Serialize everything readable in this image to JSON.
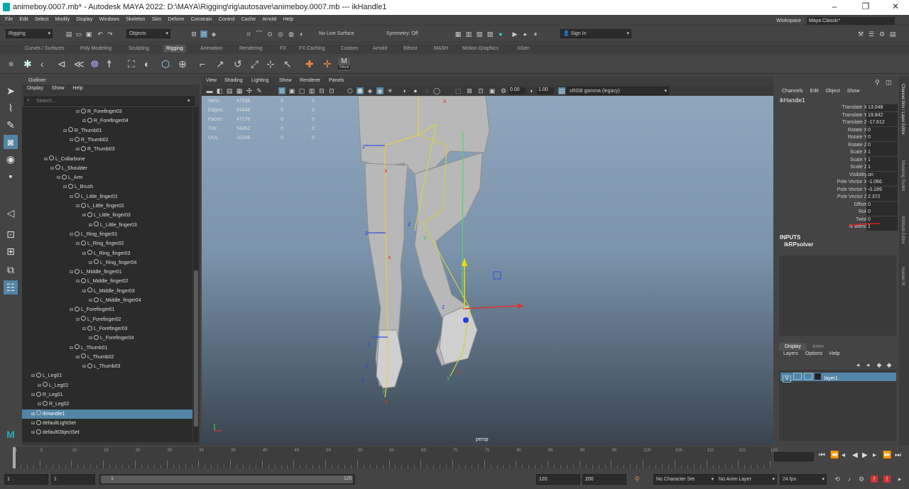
{
  "window": {
    "title": "animeboy.0007.mb* - Autodesk MAYA 2022: D:\\MAYA\\Rigging\\rig\\autosave\\animeboy.0007.mb  ---  ikHandle1"
  },
  "menubar": {
    "items": [
      "File",
      "Edit",
      "Select",
      "Modify",
      "Display",
      "Windows",
      "Skeleton",
      "Skin",
      "Deform",
      "Constrain",
      "Control",
      "Cache",
      "Arnold",
      "Help"
    ],
    "workspace_label": "Workspace :",
    "workspace_value": "Maya Classic*"
  },
  "statusline": {
    "menuset": "Rigging",
    "select_mode": "Objects",
    "live_surface": "No Live Surface",
    "symmetry": "Symmetry: Off",
    "sign_in": "Sign In"
  },
  "shelf": {
    "tabs": [
      "Curves / Surfaces",
      "Poly Modeling",
      "Sculpting",
      "Rigging",
      "Animation",
      "Rendering",
      "FX",
      "FX Caching",
      "Custom",
      "Arnold",
      "Bifrost",
      "MASH",
      "Motion Graphics",
      "XGen"
    ],
    "active": "Rigging",
    "orient_label": "Orient"
  },
  "outliner": {
    "title": "Outliner",
    "menu": [
      "Display",
      "Show",
      "Help"
    ],
    "search_placeholder": "Search...",
    "rows": [
      {
        "label": "R_Forefinger03",
        "depth": 8
      },
      {
        "label": "R_Forefinger04",
        "depth": 9
      },
      {
        "label": "R_Thumb01",
        "depth": 6
      },
      {
        "label": "R_Thumb02",
        "depth": 7
      },
      {
        "label": "R_Thumb03",
        "depth": 8
      },
      {
        "label": "L_Collarbone",
        "depth": 3
      },
      {
        "label": "L_Shoulder",
        "depth": 4
      },
      {
        "label": "L_Arm",
        "depth": 5
      },
      {
        "label": "L_Brush",
        "depth": 6
      },
      {
        "label": "L_Little_finger01",
        "depth": 7
      },
      {
        "label": "L_Little_finger02",
        "depth": 8
      },
      {
        "label": "L_Little_finger03",
        "depth": 9
      },
      {
        "label": "L_Little_finger03",
        "depth": 10
      },
      {
        "label": "L_Ring_finger01",
        "depth": 7
      },
      {
        "label": "L_Ring_finger02",
        "depth": 8
      },
      {
        "label": "L_Ring_finger03",
        "depth": 9
      },
      {
        "label": "L_Ring_finger04",
        "depth": 10
      },
      {
        "label": "L_Middle_finger01",
        "depth": 7
      },
      {
        "label": "L_Middle_finger02",
        "depth": 8
      },
      {
        "label": "L_Middle_finger03",
        "depth": 9
      },
      {
        "label": "L_Middle_finger04",
        "depth": 10
      },
      {
        "label": "L_Forefinger01",
        "depth": 7
      },
      {
        "label": "L_Forefinger02",
        "depth": 8
      },
      {
        "label": "L_Forefinger03",
        "depth": 9
      },
      {
        "label": "L_Forefinger04",
        "depth": 10
      },
      {
        "label": "L_Thumb01",
        "depth": 7
      },
      {
        "label": "L_Thumb02",
        "depth": 8
      },
      {
        "label": "L_Thumb03",
        "depth": 9
      },
      {
        "label": "L_Leg01",
        "depth": 1
      },
      {
        "label": "L_Leg02",
        "depth": 2
      },
      {
        "label": "R_Leg01",
        "depth": 1
      },
      {
        "label": "R_Leg02",
        "depth": 2
      },
      {
        "label": "ikHandle1",
        "depth": 1,
        "selected": true
      },
      {
        "label": "defaultLightSet",
        "depth": 1
      },
      {
        "label": "defaultObjectSet",
        "depth": 1
      }
    ]
  },
  "viewport": {
    "menu": [
      "View",
      "Shading",
      "Lighting",
      "Show",
      "Renderer",
      "Panels"
    ],
    "exposure": "0.00",
    "gamma": "1.00",
    "color_space": "sRGB gamma (legacy)",
    "camera": "persp",
    "hud": [
      {
        "label": "Verts:",
        "v1": "47336",
        "v2": "0",
        "v3": "0"
      },
      {
        "label": "Edges:",
        "v1": "94448",
        "v2": "0",
        "v3": "0"
      },
      {
        "label": "Faces:",
        "v1": "47176",
        "v2": "0",
        "v3": "0"
      },
      {
        "label": "Tris:",
        "v1": "94352",
        "v2": "0",
        "v3": "0"
      },
      {
        "label": "UVs:",
        "v1": "10348",
        "v2": "0",
        "v3": "0"
      }
    ]
  },
  "channelbox": {
    "menu": [
      "Channels",
      "Edit",
      "Object",
      "Show"
    ],
    "node": "ikHandle1",
    "attrs": [
      {
        "n": "Translate X",
        "v": "13.048"
      },
      {
        "n": "Translate Y",
        "v": "19.842"
      },
      {
        "n": "Translate Z",
        "v": "-17.612"
      },
      {
        "n": "Rotate X",
        "v": "0"
      },
      {
        "n": "Rotate Y",
        "v": "0"
      },
      {
        "n": "Rotate Z",
        "v": "0"
      },
      {
        "n": "Scale X",
        "v": "1"
      },
      {
        "n": "Scale Y",
        "v": "1"
      },
      {
        "n": "Scale Z",
        "v": "1"
      },
      {
        "n": "Visibility",
        "v": "on"
      },
      {
        "n": "Pole Vector X",
        "v": "-1.066"
      },
      {
        "n": "Pole Vector Y",
        "v": "-0.189"
      },
      {
        "n": "Pole Vector Z",
        "v": "2.372"
      },
      {
        "n": "Offset",
        "v": "0"
      },
      {
        "n": "Roll",
        "v": "0"
      },
      {
        "n": "Twist",
        "v": "0"
      },
      {
        "n": "Ik Blend",
        "v": "1"
      }
    ],
    "inputs_label": "INPUTS",
    "solver": "ikRPsolver",
    "layer_tabs": [
      "Display",
      "Anim"
    ],
    "layer_menu": [
      "Layers",
      "Options",
      "Help"
    ],
    "layer_vis": "V",
    "layer_name": "layer1",
    "side_tabs": [
      "Channel Box / Layer Editor",
      "Modeling Toolkit",
      "Attribute Editor",
      "Human IK"
    ]
  },
  "timeslider": {
    "ticks": [
      "1",
      "5",
      "10",
      "15",
      "20",
      "25",
      "30",
      "35",
      "40",
      "45",
      "50",
      "55",
      "60",
      "65",
      "70",
      "75",
      "80",
      "85",
      "90",
      "95",
      "100",
      "105",
      "110",
      "115",
      "120"
    ],
    "current": "1"
  },
  "rangeslider": {
    "start": "1",
    "start_inner": "1",
    "range_start": "1",
    "range_end": "120",
    "end_inner": "120",
    "end": "200",
    "character_set": "No Character Set",
    "anim_layer": "No Anim Layer",
    "fps": "24 fps"
  }
}
